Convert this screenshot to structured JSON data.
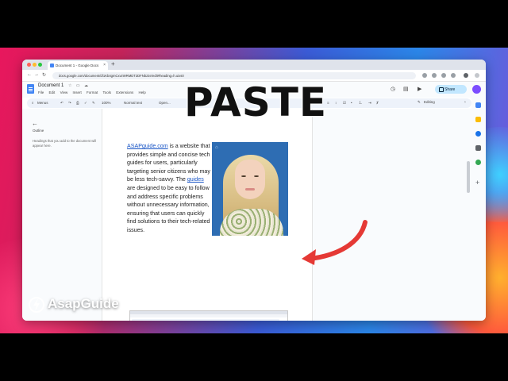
{
  "overlay": {
    "title": "PASTE",
    "brand": "AsapGuide"
  },
  "browser": {
    "tab_title": "Document 1 - Google Docs",
    "url": "docs.google.com/document/d/1Kb4gmCxvzWRMDT2DFNbz2e/edit#heading=h.uixs0"
  },
  "docs": {
    "title": "Document 1",
    "menu": [
      "File",
      "Edit",
      "View",
      "Insert",
      "Format",
      "Tools",
      "Extensions",
      "Help"
    ],
    "share_label": "Share",
    "toolbar": {
      "search": "Menus",
      "zoom": "100%",
      "style": "Normal text",
      "font": "Open...",
      "size": "11",
      "mode": "Editing"
    },
    "outline": {
      "back": "←",
      "title": "Outline",
      "hint": "Headings that you add to the document will appear here."
    },
    "body": {
      "link1": "ASAPguide.com",
      "text1": " is a website that provides simple and concise tech guides for users, particularly targeting senior citizens who may be less tech-savvy. The ",
      "link2": "guides",
      "text2": " are designed to  be easy to follow and address specific problems without  unnecessary information, ensuring that users can quickly find solutions to their tech-related issues."
    }
  },
  "colors": {
    "accent": "#1a56c6",
    "share_bg": "#c2e7ff",
    "arrow": "#e53935"
  }
}
